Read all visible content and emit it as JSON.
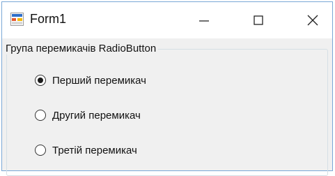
{
  "window": {
    "title": "Form1",
    "controls": {
      "minimize_icon": "minimize-icon",
      "maximize_icon": "maximize-icon",
      "close_icon": "close-icon"
    },
    "border_color": "#7aa7d6"
  },
  "groupbox": {
    "caption": "Група перемикачів RadioButton"
  },
  "radios": [
    {
      "label": "Перший перемикач",
      "checked": true
    },
    {
      "label": "Другий перемикач",
      "checked": false
    },
    {
      "label": "Третій перемикач",
      "checked": false
    }
  ]
}
